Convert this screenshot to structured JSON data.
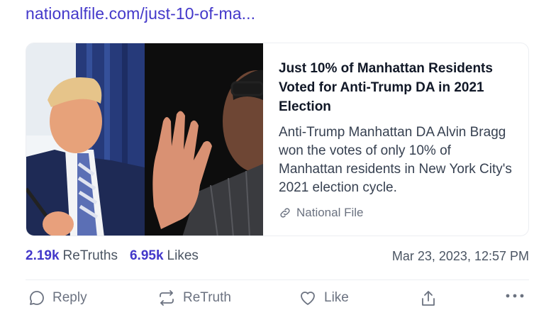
{
  "post": {
    "link_url_text": "nationalfile.com/just-10-of-ma...",
    "card": {
      "title": "Just 10% of Manhattan Residents Voted for Anti-Trump DA in 2021 Election",
      "description": "Anti-Trump Manhattan DA Alvin Bragg won the votes of only 10% of Manhattan residents in New York City's 2021 election cycle.",
      "source": "National File",
      "source_icon": "link-icon"
    },
    "stats": {
      "retruths_count": "2.19k",
      "retruths_label": "ReTruths",
      "likes_count": "6.95k",
      "likes_label": "Likes",
      "timestamp": "Mar 23, 2023, 12:57 PM"
    },
    "actions": {
      "reply_label": "Reply",
      "retruth_label": "ReTruth",
      "like_label": "Like"
    }
  },
  "colors": {
    "accent": "#4338ca",
    "muted": "#6b7280",
    "divider": "#eceef2"
  }
}
